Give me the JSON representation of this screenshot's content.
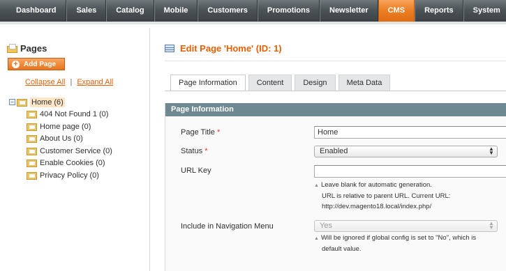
{
  "nav": {
    "items": [
      {
        "label": "Dashboard",
        "active": false
      },
      {
        "label": "Sales",
        "active": false
      },
      {
        "label": "Catalog",
        "active": false
      },
      {
        "label": "Mobile",
        "active": false
      },
      {
        "label": "Customers",
        "active": false
      },
      {
        "label": "Promotions",
        "active": false
      },
      {
        "label": "Newsletter",
        "active": false
      },
      {
        "label": "CMS",
        "active": true
      },
      {
        "label": "Reports",
        "active": false
      },
      {
        "label": "System",
        "active": false
      }
    ]
  },
  "sidebar": {
    "title": "Pages",
    "add_page_label": "Add Page",
    "collapse_all": "Collapse All",
    "separator": "|",
    "expand_all": "Expand All",
    "tree": {
      "root": {
        "label": "Home (6)",
        "toggle": "−"
      },
      "children": [
        {
          "label": "404 Not Found 1 (0)"
        },
        {
          "label": "Home page (0)"
        },
        {
          "label": "About Us (0)"
        },
        {
          "label": "Customer Service (0)"
        },
        {
          "label": "Enable Cookies (0)"
        },
        {
          "label": "Privacy Policy (0)"
        }
      ]
    }
  },
  "main": {
    "heading": "Edit Page 'Home' (ID: 1)",
    "tabs": [
      {
        "label": "Page Information",
        "active": true
      },
      {
        "label": "Content",
        "active": false
      },
      {
        "label": "Design",
        "active": false
      },
      {
        "label": "Meta Data",
        "active": false
      }
    ],
    "section_title": "Page Information",
    "form": {
      "page_title_label": "Page Title",
      "page_title_value": "Home",
      "status_label": "Status",
      "status_value": "Enabled",
      "url_key_label": "URL Key",
      "url_key_value": "",
      "url_note_1": "Leave blank for automatic generation.",
      "url_note_2": "URL is relative to parent URL. Current URL:",
      "url_note_3": "http://dev.magento18.local/index.php/",
      "nav_menu_label": "Include in Navigation Menu",
      "nav_menu_value": "Yes",
      "nav_note_1": "Will be ignored if global config is set to \"No\", which is",
      "nav_note_2": "default value.",
      "required_mark": "*"
    }
  },
  "colors": {
    "accent": "#eb5e00",
    "active_tab": "#eb7d23",
    "section_header": "#6f8992"
  }
}
